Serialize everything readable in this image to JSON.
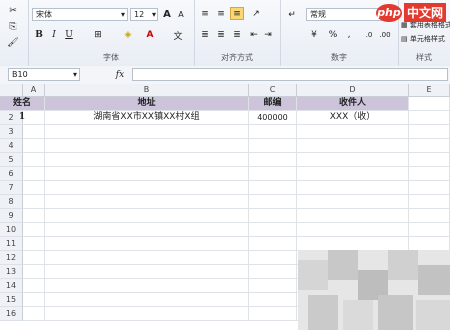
{
  "ribbon": {
    "font_name": "宋体",
    "font_size": "12",
    "number_format": "常规",
    "groups": {
      "font": "字体",
      "alignment": "对齐方式",
      "number": "数字",
      "styles": "样式"
    },
    "styles_items": [
      "套用表格格式",
      "单元格样式"
    ]
  },
  "formula_bar": {
    "name_box": "B10",
    "fx": "fx",
    "value": ""
  },
  "columns": [
    "A",
    "B",
    "C",
    "D",
    "E"
  ],
  "rows": [
    "1",
    "2",
    "3",
    "4",
    "5",
    "6",
    "7",
    "8",
    "9",
    "10",
    "11",
    "12",
    "13",
    "14",
    "15",
    "16"
  ],
  "table": {
    "headers": [
      "姓名",
      "地址",
      "邮编",
      "收件人"
    ],
    "row2": [
      "1",
      "湖南省XX市XX镇XX村X组",
      "400000",
      "XXX（收）"
    ]
  },
  "watermark": {
    "badge": "php",
    "text": "中文网"
  },
  "colors": {
    "header_fill": "#cdc4dc",
    "ribbon_bg": "#eef2f7",
    "watermark": "#e23a2e"
  }
}
